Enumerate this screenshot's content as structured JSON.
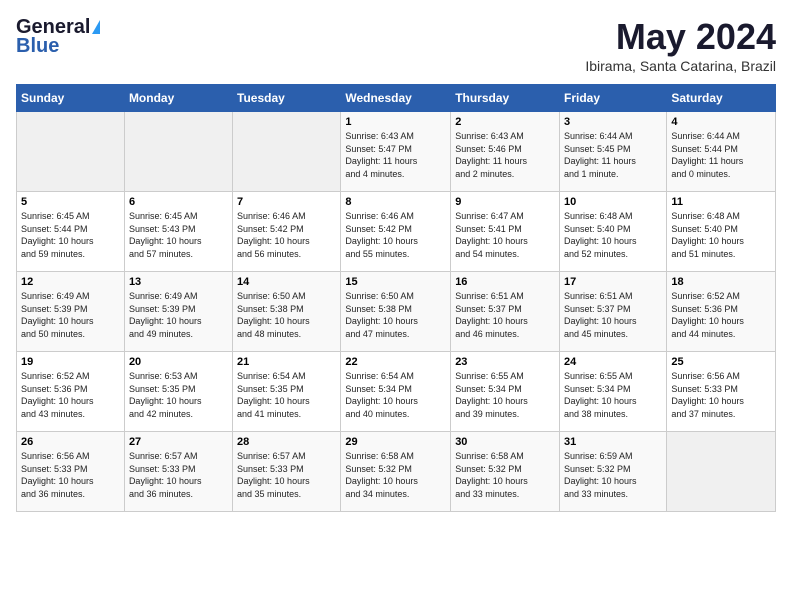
{
  "header": {
    "logo_general": "General",
    "logo_blue": "Blue",
    "month_title": "May 2024",
    "location": "Ibirama, Santa Catarina, Brazil"
  },
  "days_of_week": [
    "Sunday",
    "Monday",
    "Tuesday",
    "Wednesday",
    "Thursday",
    "Friday",
    "Saturday"
  ],
  "weeks": [
    [
      {
        "day": "",
        "info": ""
      },
      {
        "day": "",
        "info": ""
      },
      {
        "day": "",
        "info": ""
      },
      {
        "day": "1",
        "info": "Sunrise: 6:43 AM\nSunset: 5:47 PM\nDaylight: 11 hours\nand 4 minutes."
      },
      {
        "day": "2",
        "info": "Sunrise: 6:43 AM\nSunset: 5:46 PM\nDaylight: 11 hours\nand 2 minutes."
      },
      {
        "day": "3",
        "info": "Sunrise: 6:44 AM\nSunset: 5:45 PM\nDaylight: 11 hours\nand 1 minute."
      },
      {
        "day": "4",
        "info": "Sunrise: 6:44 AM\nSunset: 5:44 PM\nDaylight: 11 hours\nand 0 minutes."
      }
    ],
    [
      {
        "day": "5",
        "info": "Sunrise: 6:45 AM\nSunset: 5:44 PM\nDaylight: 10 hours\nand 59 minutes."
      },
      {
        "day": "6",
        "info": "Sunrise: 6:45 AM\nSunset: 5:43 PM\nDaylight: 10 hours\nand 57 minutes."
      },
      {
        "day": "7",
        "info": "Sunrise: 6:46 AM\nSunset: 5:42 PM\nDaylight: 10 hours\nand 56 minutes."
      },
      {
        "day": "8",
        "info": "Sunrise: 6:46 AM\nSunset: 5:42 PM\nDaylight: 10 hours\nand 55 minutes."
      },
      {
        "day": "9",
        "info": "Sunrise: 6:47 AM\nSunset: 5:41 PM\nDaylight: 10 hours\nand 54 minutes."
      },
      {
        "day": "10",
        "info": "Sunrise: 6:48 AM\nSunset: 5:40 PM\nDaylight: 10 hours\nand 52 minutes."
      },
      {
        "day": "11",
        "info": "Sunrise: 6:48 AM\nSunset: 5:40 PM\nDaylight: 10 hours\nand 51 minutes."
      }
    ],
    [
      {
        "day": "12",
        "info": "Sunrise: 6:49 AM\nSunset: 5:39 PM\nDaylight: 10 hours\nand 50 minutes."
      },
      {
        "day": "13",
        "info": "Sunrise: 6:49 AM\nSunset: 5:39 PM\nDaylight: 10 hours\nand 49 minutes."
      },
      {
        "day": "14",
        "info": "Sunrise: 6:50 AM\nSunset: 5:38 PM\nDaylight: 10 hours\nand 48 minutes."
      },
      {
        "day": "15",
        "info": "Sunrise: 6:50 AM\nSunset: 5:38 PM\nDaylight: 10 hours\nand 47 minutes."
      },
      {
        "day": "16",
        "info": "Sunrise: 6:51 AM\nSunset: 5:37 PM\nDaylight: 10 hours\nand 46 minutes."
      },
      {
        "day": "17",
        "info": "Sunrise: 6:51 AM\nSunset: 5:37 PM\nDaylight: 10 hours\nand 45 minutes."
      },
      {
        "day": "18",
        "info": "Sunrise: 6:52 AM\nSunset: 5:36 PM\nDaylight: 10 hours\nand 44 minutes."
      }
    ],
    [
      {
        "day": "19",
        "info": "Sunrise: 6:52 AM\nSunset: 5:36 PM\nDaylight: 10 hours\nand 43 minutes."
      },
      {
        "day": "20",
        "info": "Sunrise: 6:53 AM\nSunset: 5:35 PM\nDaylight: 10 hours\nand 42 minutes."
      },
      {
        "day": "21",
        "info": "Sunrise: 6:54 AM\nSunset: 5:35 PM\nDaylight: 10 hours\nand 41 minutes."
      },
      {
        "day": "22",
        "info": "Sunrise: 6:54 AM\nSunset: 5:34 PM\nDaylight: 10 hours\nand 40 minutes."
      },
      {
        "day": "23",
        "info": "Sunrise: 6:55 AM\nSunset: 5:34 PM\nDaylight: 10 hours\nand 39 minutes."
      },
      {
        "day": "24",
        "info": "Sunrise: 6:55 AM\nSunset: 5:34 PM\nDaylight: 10 hours\nand 38 minutes."
      },
      {
        "day": "25",
        "info": "Sunrise: 6:56 AM\nSunset: 5:33 PM\nDaylight: 10 hours\nand 37 minutes."
      }
    ],
    [
      {
        "day": "26",
        "info": "Sunrise: 6:56 AM\nSunset: 5:33 PM\nDaylight: 10 hours\nand 36 minutes."
      },
      {
        "day": "27",
        "info": "Sunrise: 6:57 AM\nSunset: 5:33 PM\nDaylight: 10 hours\nand 36 minutes."
      },
      {
        "day": "28",
        "info": "Sunrise: 6:57 AM\nSunset: 5:33 PM\nDaylight: 10 hours\nand 35 minutes."
      },
      {
        "day": "29",
        "info": "Sunrise: 6:58 AM\nSunset: 5:32 PM\nDaylight: 10 hours\nand 34 minutes."
      },
      {
        "day": "30",
        "info": "Sunrise: 6:58 AM\nSunset: 5:32 PM\nDaylight: 10 hours\nand 33 minutes."
      },
      {
        "day": "31",
        "info": "Sunrise: 6:59 AM\nSunset: 5:32 PM\nDaylight: 10 hours\nand 33 minutes."
      },
      {
        "day": "",
        "info": ""
      }
    ]
  ]
}
